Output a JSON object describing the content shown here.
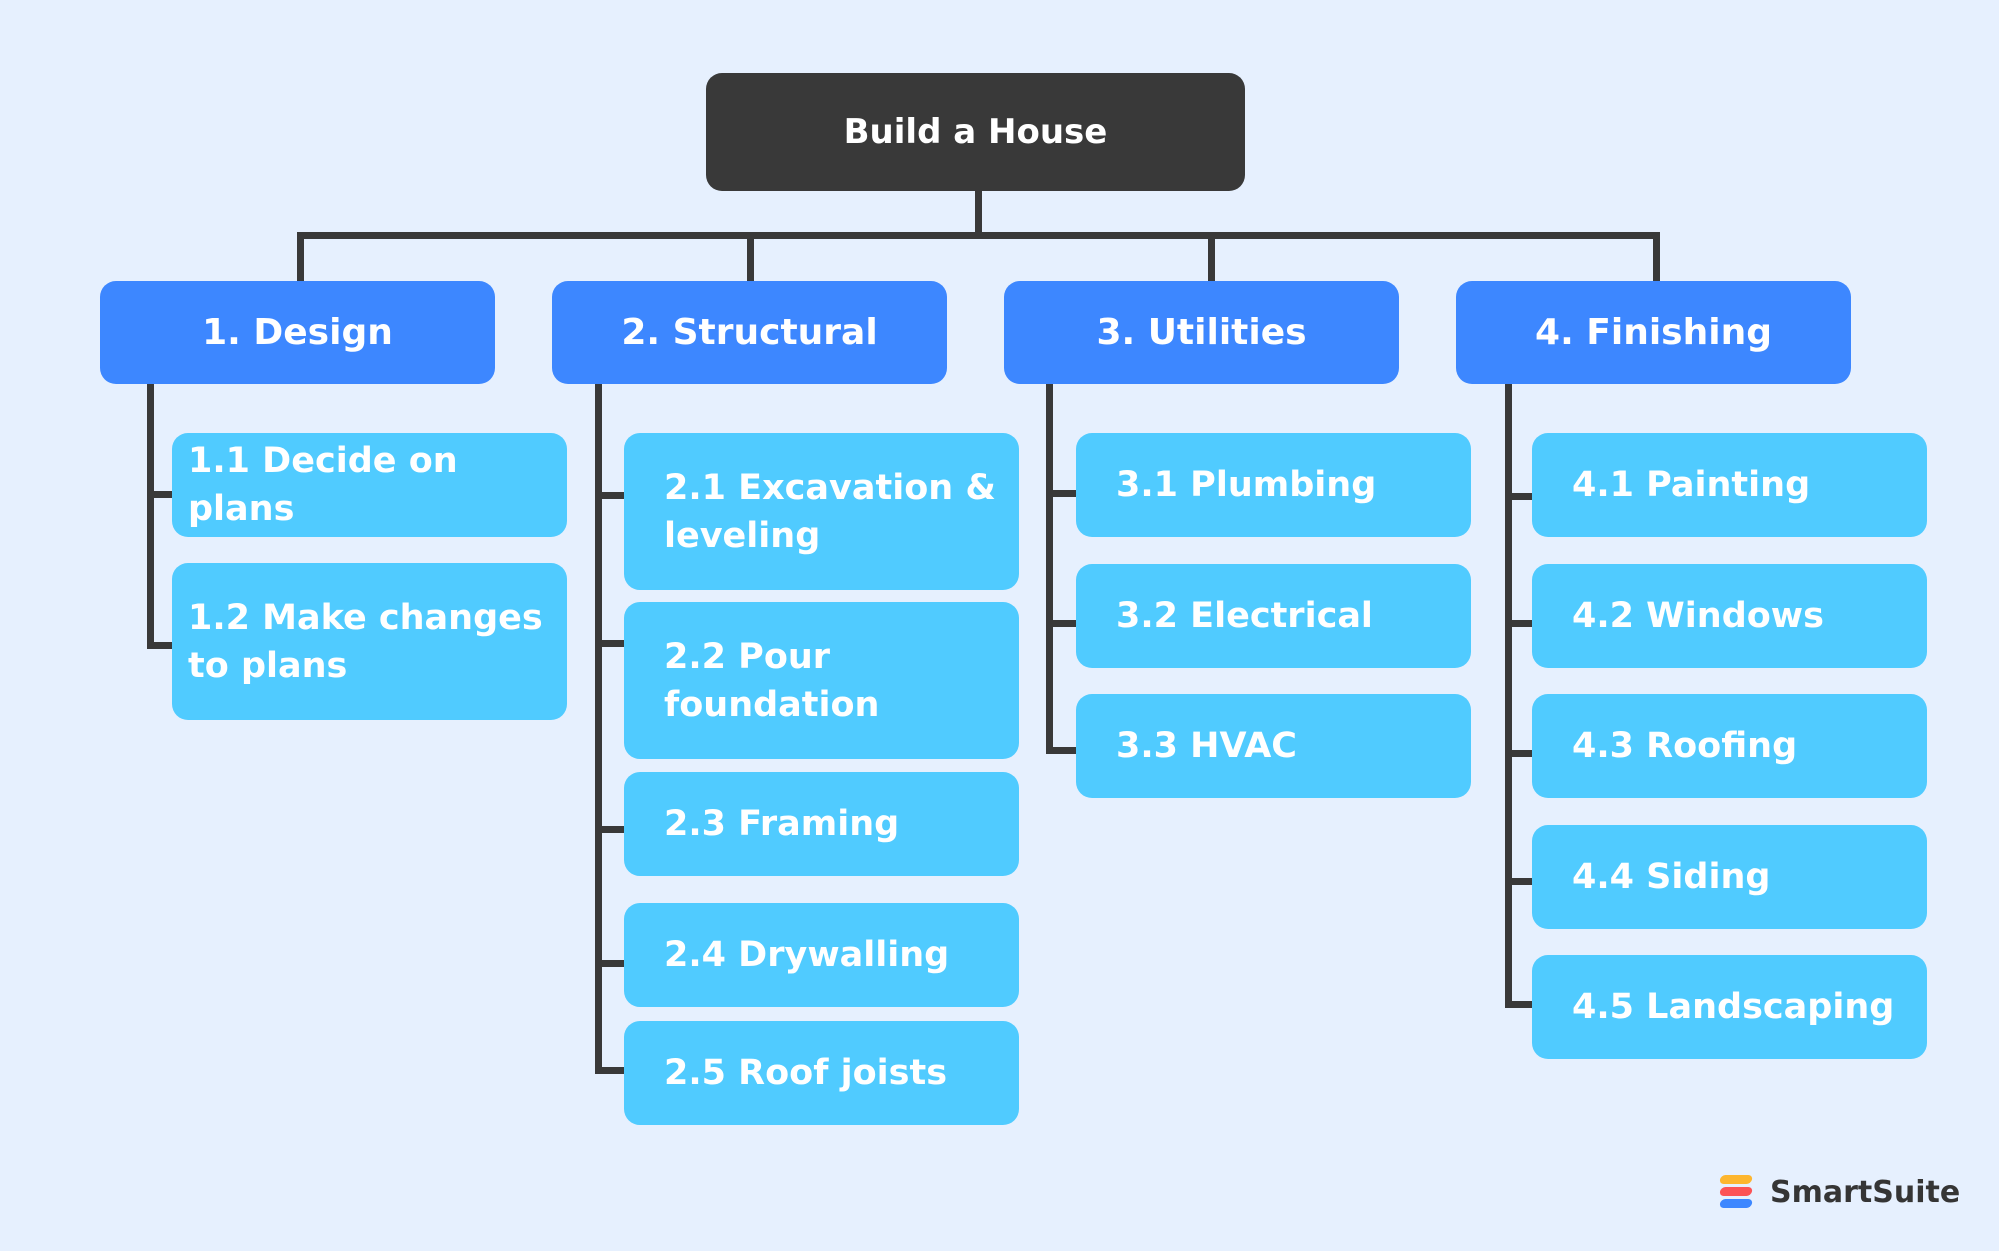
{
  "root": {
    "label": "Build a House"
  },
  "categories": [
    {
      "label": "1. Design",
      "children": [
        "1.1 Decide on plans",
        "1.2 Make changes to plans"
      ]
    },
    {
      "label": "2. Structural",
      "children": [
        "2.1 Excavation & leveling",
        "2.2 Pour foundation",
        "2.3 Framing",
        "2.4 Drywalling",
        "2.5 Roof joists"
      ]
    },
    {
      "label": "3. Utilities",
      "children": [
        "3.1 Plumbing",
        "3.2 Electrical",
        "3.3 HVAC"
      ]
    },
    {
      "label": "4. Finishing",
      "children": [
        "4.1 Painting",
        "4.2 Windows",
        "4.3 Roofing",
        "4.4 Siding",
        "4.5 Landscaping"
      ]
    }
  ],
  "brand": {
    "name": "SmartSuite",
    "logo_icon": "smartsuite-logo-icon"
  },
  "colors": {
    "background": "#e6f0fe",
    "root": "#393939",
    "category": "#3d87ff",
    "task": "#50cbff",
    "connector": "#393939",
    "logo": [
      "#fdb62f",
      "#fc5356",
      "#3d87ff"
    ]
  }
}
